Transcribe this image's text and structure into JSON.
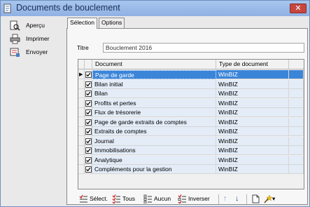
{
  "window": {
    "title": "Documents de bouclement",
    "close_glyph": "✕"
  },
  "sidebar": {
    "items": [
      {
        "label": "Aperçu",
        "icon": "preview-icon"
      },
      {
        "label": "Imprimer",
        "icon": "printer-icon"
      },
      {
        "label": "Envoyer",
        "icon": "send-icon"
      }
    ]
  },
  "tabs": [
    {
      "label": "Sélection",
      "active": true
    },
    {
      "label": "Options",
      "active": false
    }
  ],
  "form": {
    "titre_label": "Titre",
    "titre_value": "Bouclement 2016"
  },
  "grid": {
    "columns": [
      "Document",
      "Type de document"
    ],
    "rows": [
      {
        "document": "Page de garde",
        "type": "WinBIZ",
        "checked": true,
        "selected": true
      },
      {
        "document": "Bilan initial",
        "type": "WinBIZ",
        "checked": true
      },
      {
        "document": "Bilan",
        "type": "WinBIZ",
        "checked": true
      },
      {
        "document": "Profits et pertes",
        "type": "WinBIZ",
        "checked": true
      },
      {
        "document": "Flux de trésorerie",
        "type": "WinBIZ",
        "checked": true
      },
      {
        "document": "Page de garde extraits de comptes",
        "type": "WinBIZ",
        "checked": true
      },
      {
        "document": "Extraits de comptes",
        "type": "WinBIZ",
        "checked": true
      },
      {
        "document": "Journal",
        "type": "WinBIZ",
        "checked": true
      },
      {
        "document": "Immobilisations",
        "type": "WinBIZ",
        "checked": true
      },
      {
        "document": "Analytique",
        "type": "WinBIZ",
        "checked": true
      },
      {
        "document": "Compléments pour la gestion",
        "type": "WinBIZ",
        "checked": true
      }
    ],
    "row_indicator": "▶"
  },
  "toolbar": {
    "select_label": "Sélect.",
    "all_label": "Tous",
    "none_label": "Aucun",
    "invert_label": "Inverser",
    "up_glyph": "↑",
    "down_glyph": "↓",
    "dropdown_glyph": "▾"
  },
  "colors": {
    "selection": "#3b85d9",
    "titlebar": "#9dbde9",
    "row_bg": "#e3ecf7"
  }
}
